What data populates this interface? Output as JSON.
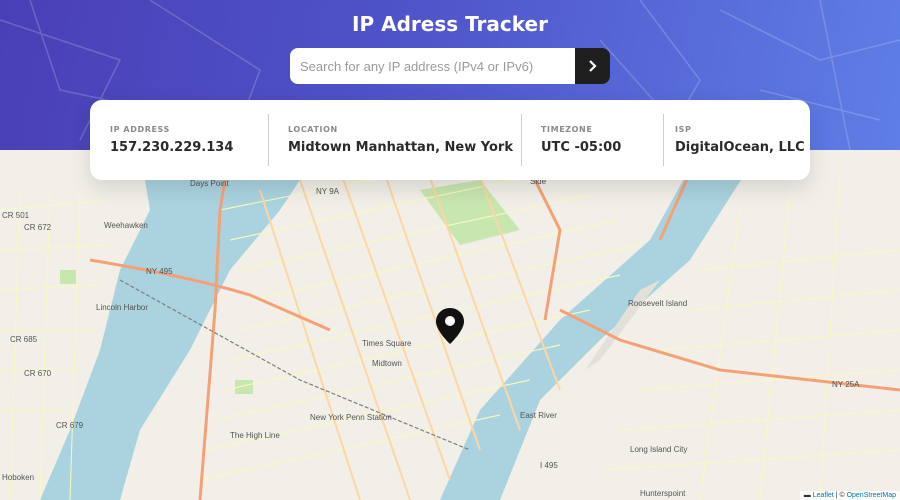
{
  "header": {
    "title": "IP Adress Tracker"
  },
  "search": {
    "placeholder": "Search for any IP address (IPv4 or IPv6)",
    "value": ""
  },
  "info": [
    {
      "label": "IP Address",
      "value": "157.230.229.134"
    },
    {
      "label": "Location",
      "value": "Midtown Manhattan, New York"
    },
    {
      "label": "Timezone",
      "value": "UTC -05:00"
    },
    {
      "label": "ISP",
      "value": "DigitalOcean, LLC"
    }
  ],
  "map": {
    "labels": {
      "weehawken": "Weehawken",
      "hoboken": "Hoboken",
      "lincoln_harbor": "Lincoln Harbor",
      "days_point": "Days Point",
      "times_square": "Times Square",
      "midtown": "Midtown",
      "penn_station": "New York Penn Station",
      "high_line": "The High Line",
      "roosevelt_island": "Roosevelt Island",
      "long_island_city": "Long Island City",
      "east_river": "East River",
      "cr501": "CR 501",
      "cr672": "CR 672",
      "cr685": "CR 685",
      "cr670": "CR 670",
      "cr679": "CR 679",
      "ny495": "NY 495",
      "ny9a": "NY 9A",
      "ny25a": "NY 25A",
      "i495": "I 495",
      "side": "Side",
      "hunterspoint": "Hunterspoint"
    },
    "attribution": {
      "leaflet": "Leaflet",
      "separator": " | © ",
      "osm": "OpenStreetMap"
    },
    "colors": {
      "water": "#aad3df",
      "land": "#f2efe9",
      "park": "#c8e6b0",
      "highway": "#f4a178",
      "primary": "#fcd6a4",
      "secondary": "#f7fabf"
    }
  },
  "icons": {
    "search_button": "chevron-right-icon",
    "marker": "location-pin-icon"
  }
}
